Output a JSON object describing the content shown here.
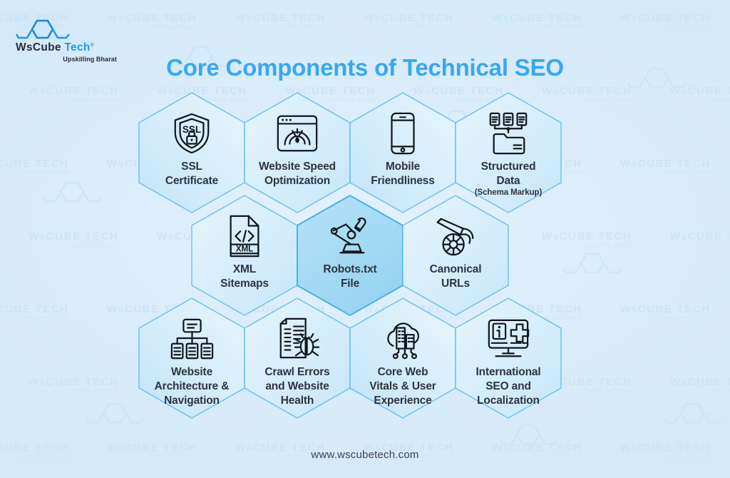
{
  "brand": {
    "name_ws": "WsCube",
    "name_tech": "Tech",
    "registered": "®",
    "tagline": "Upskilling Bharat",
    "logo_icon": "hexagon-logo-icon"
  },
  "header": {
    "title": "Core Components of Technical SEO",
    "title_color": "#38a8f0"
  },
  "footer": {
    "website": "www.wscubetech.com"
  },
  "colors": {
    "background": "#d9ecfb",
    "hex_fill": "#d2ecfb",
    "hex_fill_alt": "#c9e8fa",
    "hex_center_fill": "#a3d9f4",
    "hex_stroke": "#45b2e8",
    "text": "#2e3440",
    "accent": "#38a8f0",
    "watermark": "#c6e2f4"
  },
  "watermark": {
    "text_main": "WsCube Tech",
    "text_sub": "Upskilling Bharat"
  },
  "diagram": {
    "type": "honeycomb",
    "rows": 3,
    "cells": [
      {
        "id": "ssl-certificate",
        "label": "SSL\nCertificate",
        "line1": "SSL",
        "line2": "Certificate",
        "sublabel": "",
        "icon": "ssl-shield-lock-icon",
        "row": 1,
        "col": 1,
        "highlight": false
      },
      {
        "id": "website-speed-optimization",
        "label": "Website Speed\nOptimization",
        "line1": "Website Speed",
        "line2": "Optimization",
        "sublabel": "",
        "icon": "speedometer-browser-icon",
        "row": 1,
        "col": 2,
        "highlight": false
      },
      {
        "id": "mobile-friendliness",
        "label": "Mobile\nFriendliness",
        "line1": "Mobile",
        "line2": "Friendliness",
        "sublabel": "",
        "icon": "mobile-phone-icon",
        "row": 1,
        "col": 3,
        "highlight": false
      },
      {
        "id": "structured-data",
        "label": "Structured\nData",
        "line1": "Structured",
        "line2": "Data",
        "sublabel": "(Schema Markup)",
        "icon": "folder-documents-icon",
        "row": 1,
        "col": 4,
        "highlight": false
      },
      {
        "id": "xml-sitemaps",
        "label": "XML\nSitemaps",
        "line1": "XML",
        "line2": "Sitemaps",
        "sublabel": "",
        "icon": "xml-code-file-icon",
        "row": 2,
        "col": 1,
        "highlight": false
      },
      {
        "id": "robots-txt-file",
        "label": "Robots.txt\nFile",
        "line1": "Robots.txt",
        "line2": "File",
        "sublabel": "",
        "icon": "robot-arm-icon",
        "row": 2,
        "col": 2,
        "highlight": true
      },
      {
        "id": "canonical-urls",
        "label": "Canonical\nURLs",
        "line1": "Canonical",
        "line2": "URLs",
        "sublabel": "",
        "icon": "cannon-icon",
        "row": 2,
        "col": 3,
        "highlight": false
      },
      {
        "id": "website-architecture-navigation",
        "label": "Website\nArchitecture &\nNavigation",
        "line1": "Website",
        "line2": "Architecture &",
        "line3": "Navigation",
        "sublabel": "",
        "icon": "sitemap-tree-icon",
        "row": 3,
        "col": 1,
        "highlight": false
      },
      {
        "id": "crawl-errors-website-health",
        "label": "Crawl Errors\nand Website\nHealth",
        "line1": "Crawl Errors",
        "line2": "and Website",
        "line3": "Health",
        "sublabel": "",
        "icon": "document-bug-icon",
        "row": 3,
        "col": 2,
        "highlight": false
      },
      {
        "id": "core-web-vitals-user-experience",
        "label": "Core Web\nVitals & User\nExperience",
        "line1": "Core Web",
        "line2": "Vitals & User",
        "line3": "Experience",
        "sublabel": "",
        "icon": "cloud-city-icon",
        "row": 3,
        "col": 3,
        "highlight": false
      },
      {
        "id": "international-seo-localization",
        "label": "International\nSEO and\nLocalization",
        "line1": "International",
        "line2": "SEO and",
        "line3": "Localization",
        "sublabel": "",
        "icon": "monitor-info-plus-icon",
        "row": 3,
        "col": 4,
        "highlight": false
      }
    ]
  }
}
